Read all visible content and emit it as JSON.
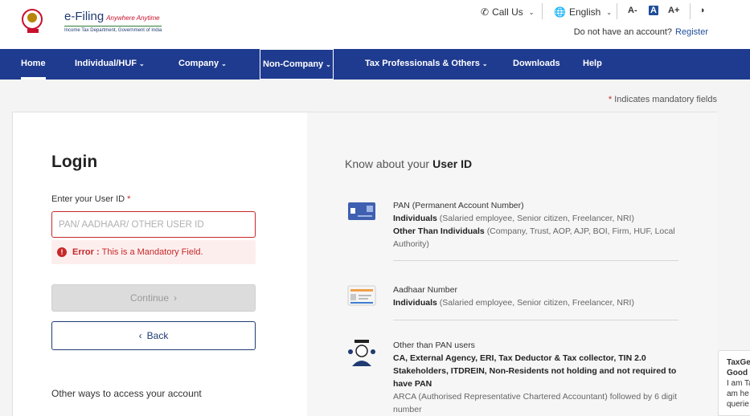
{
  "header": {
    "brand_name": "e-Filing",
    "brand_tagline": "Anywhere Anytime",
    "brand_subtitle": "Income Tax Department, Government of India",
    "call_us": "Call Us",
    "language": "English",
    "font_decrease": "A-",
    "font_normal": "A",
    "font_increase": "A+",
    "no_account_text": "Do not have an account?",
    "register_link": "Register"
  },
  "nav": {
    "items": [
      {
        "label": "Home"
      },
      {
        "label": "Individual/HUF"
      },
      {
        "label": "Company"
      },
      {
        "label": "Non-Company"
      },
      {
        "label": "Tax Professionals & Others"
      },
      {
        "label": "Downloads"
      },
      {
        "label": "Help"
      }
    ]
  },
  "mandatory_note": "Indicates mandatory fields",
  "login": {
    "title": "Login",
    "field_label": "Enter your User ID",
    "required_marker": "*",
    "input_placeholder": "PAN/ AADHAAR/ OTHER USER ID",
    "input_value": "",
    "error_label": "Error :",
    "error_message": "This is a Mandatory Field.",
    "continue_label": "Continue",
    "back_label": "Back",
    "other_ways": "Other ways to access your account"
  },
  "know": {
    "title_prefix": "Know about your",
    "title_bold": "User ID",
    "items": [
      {
        "icon": "pan-card-icon",
        "title": "PAN (Permanent Account Number)",
        "line1_bold": "Individuals",
        "line1_rest": "(Salaried employee, Senior citizen, Freelancer, NRI)",
        "line2_bold": "Other Than Individuals",
        "line2_rest": "(Company, Trust, AOP, AJP, BOI, Firm, HUF, Local Authority)"
      },
      {
        "icon": "aadhaar-card-icon",
        "title": "Aadhaar Number",
        "line1_bold": "Individuals",
        "line1_rest": "(Salaried employee, Senior citizen, Freelancer, NRI)"
      },
      {
        "icon": "other-users-icon",
        "title": "Other than PAN users",
        "bold_block": "CA, External Agency, ERI, Tax Deductor & Tax collector, TIN 2.0 Stakeholders, ITDREIN, Non-Residents not holding and not required to have PAN",
        "muted": "ARCA (Authorised Representative Chartered Accountant) followed by 6 digit number"
      }
    ]
  },
  "chat": {
    "line1": "TaxGe",
    "line2": "Good",
    "line3": "I am Ta",
    "line4": "am he",
    "line5": "querie"
  },
  "colors": {
    "nav_bg": "#1f3b8f",
    "error": "#c62828",
    "link": "#1f4e9c"
  }
}
